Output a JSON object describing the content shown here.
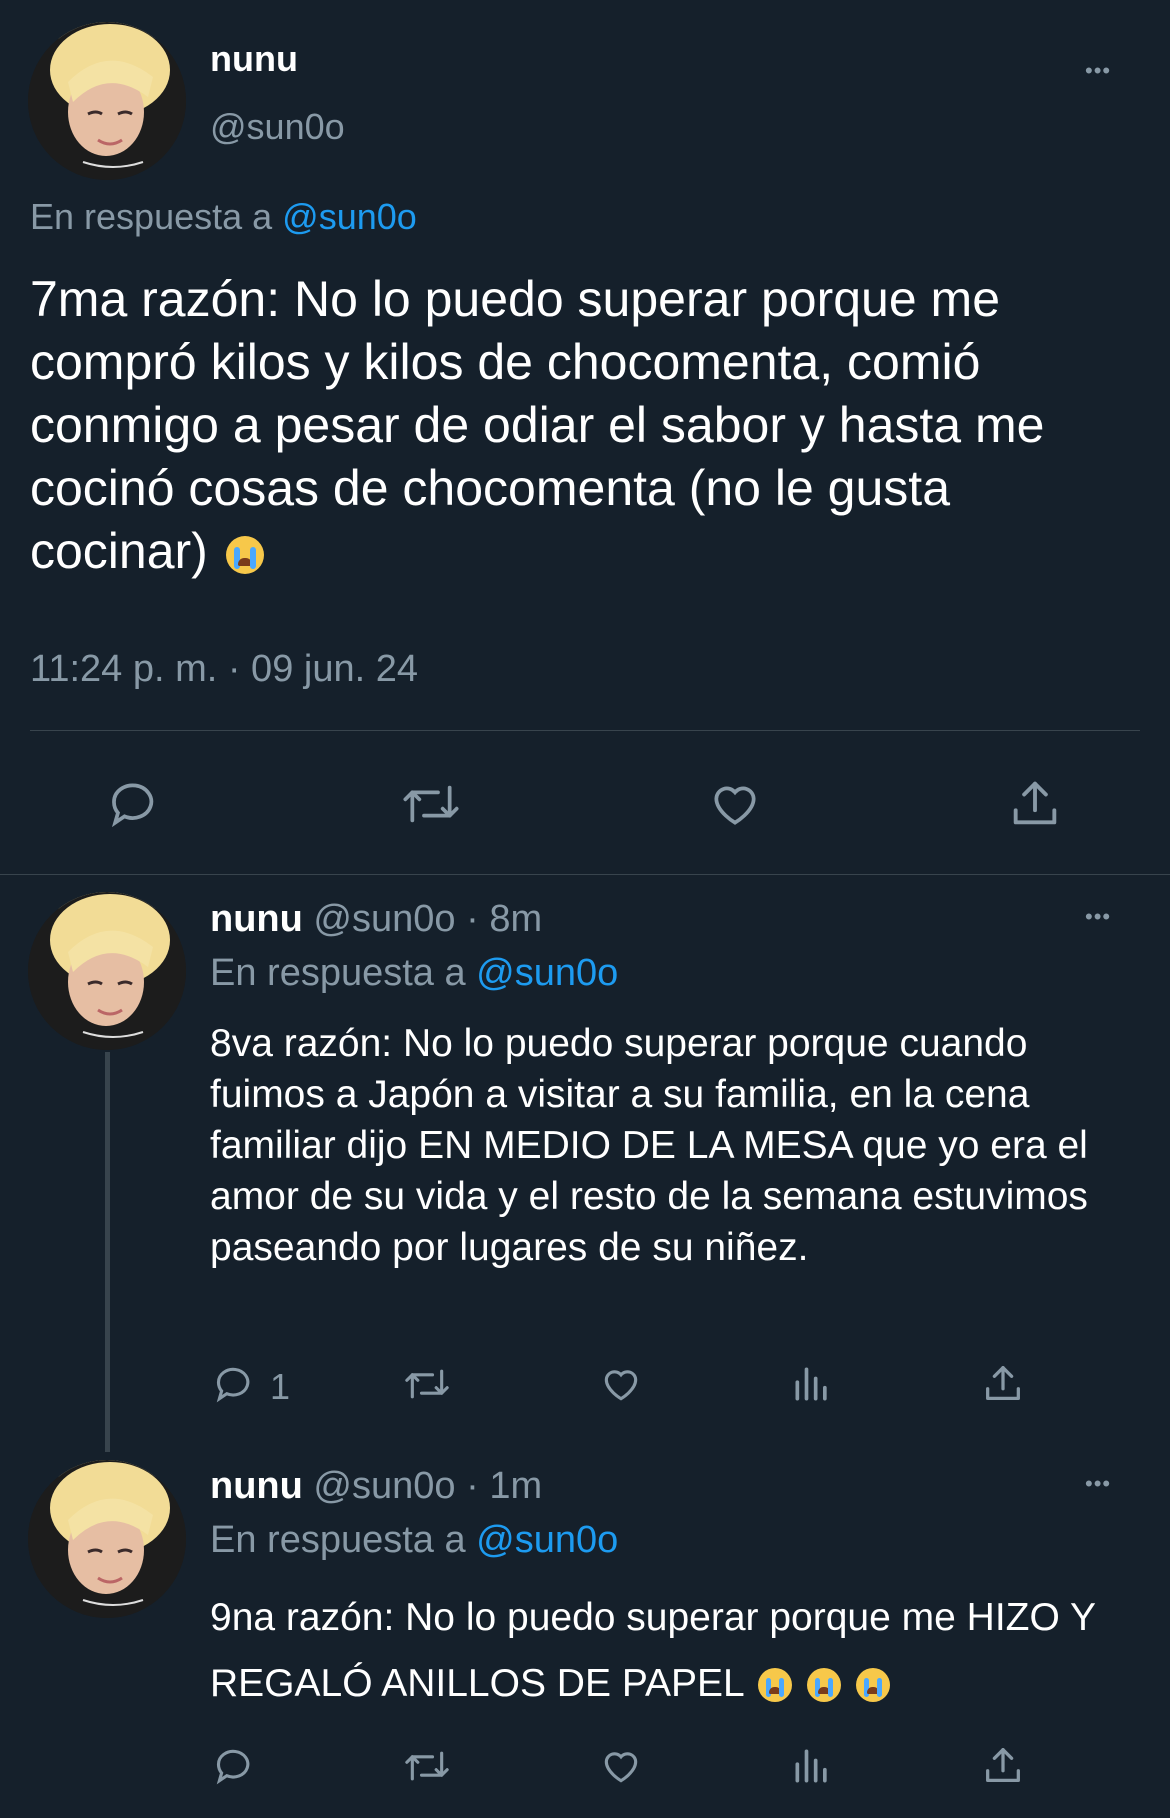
{
  "main_tweet": {
    "name": "nunu",
    "handle": "@sun0o",
    "reply_prefix": "En respuesta a",
    "reply_to": "@sun0o",
    "text": "7ma razón: No lo puedo superar porque me compró kilos y kilos de chocomenta, comió conmigo a pesar de odiar el sabor y hasta me cocinó cosas de chocomenta (no le gusta cocinar)",
    "emoji": "loudly-crying-face",
    "timestamp": "11:24 p. m. · 09 jun. 24"
  },
  "replies": [
    {
      "name": "nunu",
      "handle": "@sun0o",
      "time": "· 8m",
      "reply_prefix": "En respuesta a",
      "reply_to": "@sun0o",
      "text": "8va razón: No lo puedo superar porque cuando fuimos a Japón a visitar a su familia, en la cena familiar dijo EN MEDIO DE LA MESA que yo era el amor de su vida y el resto de la semana estuvimos paseando por lugares de su niñez.",
      "reply_count": "1"
    },
    {
      "name": "nunu",
      "handle": "@sun0o",
      "time": "· 1m",
      "reply_prefix": "En respuesta a",
      "reply_to": "@sun0o",
      "text": "9na razón: No lo puedo superar porque me HIZO Y REGALÓ ANILLOS DE PAPEL",
      "emoji_count": 3
    }
  ],
  "more_menu_glyph": "•••",
  "colors": {
    "background": "#15202b",
    "muted": "#8899a6",
    "link": "#1d9bf0",
    "divider": "#38444d"
  }
}
